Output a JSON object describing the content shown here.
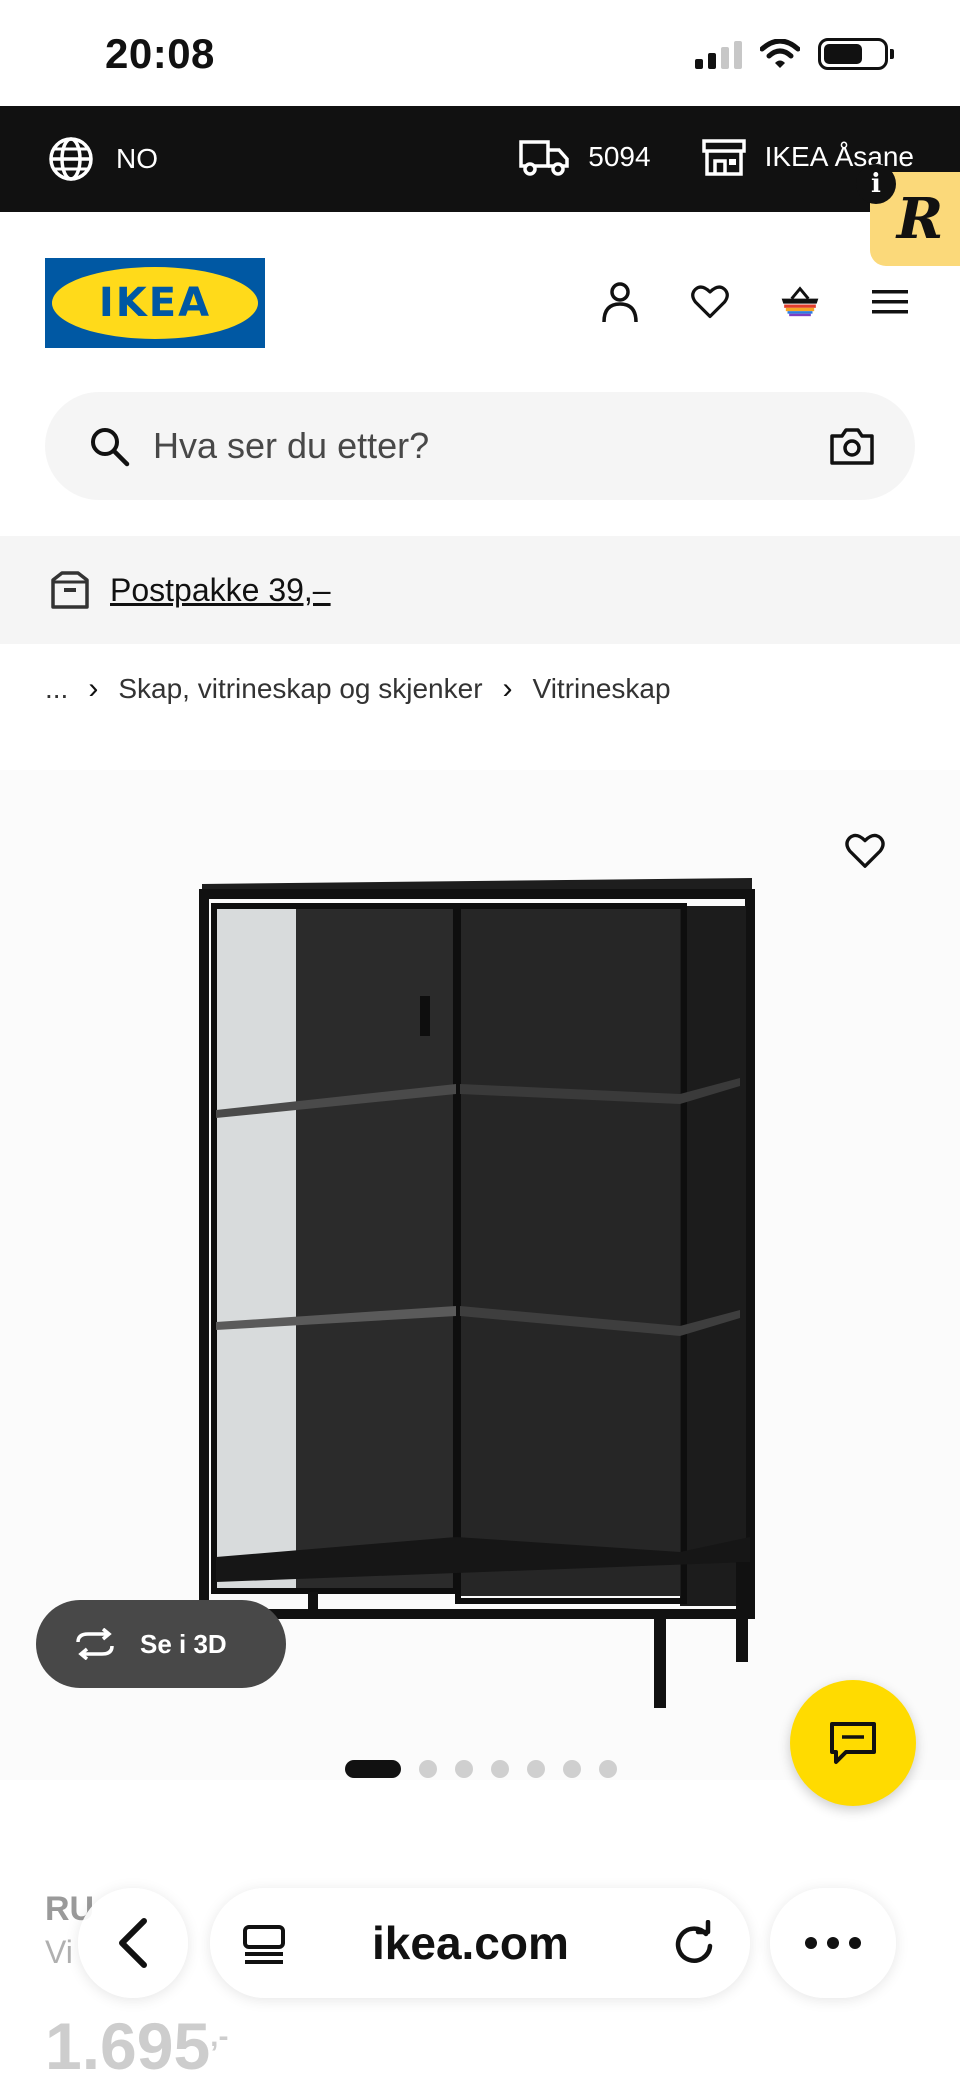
{
  "status_bar": {
    "time": "20:08"
  },
  "top_bar": {
    "language": "NO",
    "postcode": "5094",
    "store": "IKEA Åsane"
  },
  "header": {
    "logo_text": "IKEA",
    "icons": [
      "account-icon",
      "heart-icon",
      "basket-icon",
      "menu-icon"
    ]
  },
  "search": {
    "placeholder": "Hva ser du etter?"
  },
  "promo": {
    "label": "Postpakke 39,–"
  },
  "breadcrumb": {
    "ellipsis": "...",
    "items": [
      "Skap, vitrineskap og skjenker",
      "Vitrineskap"
    ]
  },
  "gallery": {
    "view_3d_label": "Se i 3D",
    "image_count": 7,
    "active_index": 0
  },
  "product": {
    "name": "RU",
    "description": "Vi",
    "price": "1.695",
    "price_suffix": ",-"
  },
  "browser": {
    "url": "ikea.com"
  },
  "colors": {
    "ikea_blue": "#0058a3",
    "ikea_yellow": "#ffda1a",
    "chat_yellow": "#ffdb00",
    "dark_bar": "#111111"
  }
}
